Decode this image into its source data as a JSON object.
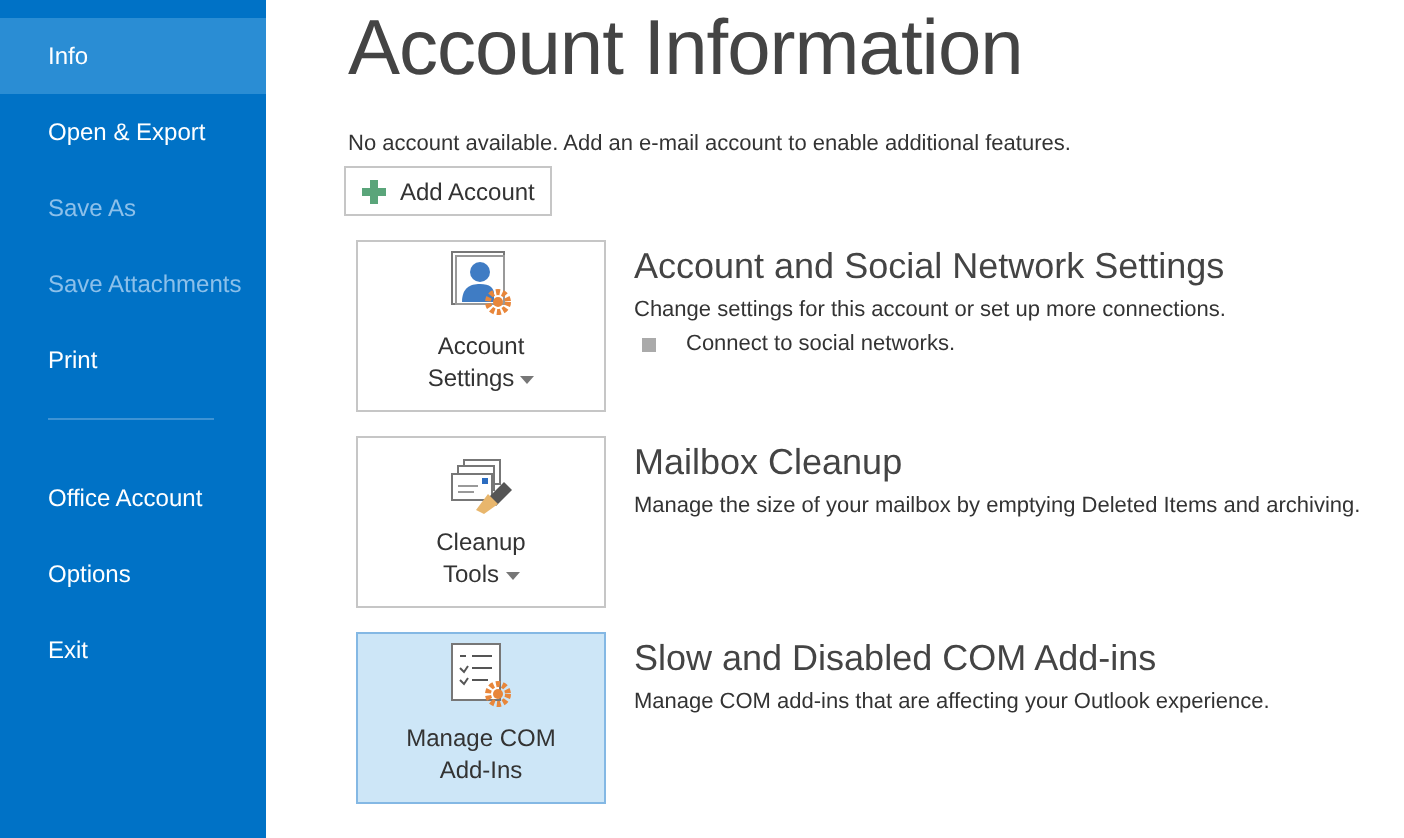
{
  "sidebar": {
    "items": [
      {
        "label": "Info",
        "selected": true,
        "disabled": false
      },
      {
        "label": "Open & Export",
        "selected": false,
        "disabled": false
      },
      {
        "label": "Save As",
        "selected": false,
        "disabled": true
      },
      {
        "label": "Save Attachments",
        "selected": false,
        "disabled": true
      },
      {
        "label": "Print",
        "selected": false,
        "disabled": false
      },
      {
        "kind": "divider"
      },
      {
        "label": "Office Account",
        "selected": false,
        "disabled": false
      },
      {
        "label": "Options",
        "selected": false,
        "disabled": false
      },
      {
        "label": "Exit",
        "selected": false,
        "disabled": false
      }
    ]
  },
  "title": "Account Information",
  "notice": "No account available. Add an e-mail account to enable additional features.",
  "add_button": "Add Account",
  "sections": [
    {
      "kind": "account",
      "button_lines": [
        "Account",
        "Settings"
      ],
      "dropdown": true,
      "highlighted": false,
      "heading": "Account and Social Network Settings",
      "description": "Change settings for this account or set up more connections.",
      "bullets": [
        "Connect to social networks."
      ]
    },
    {
      "kind": "cleanup",
      "button_lines": [
        "Cleanup",
        "Tools"
      ],
      "dropdown": true,
      "highlighted": false,
      "heading": "Mailbox Cleanup",
      "description": "Manage the size of your mailbox by emptying Deleted Items and archiving."
    },
    {
      "kind": "addins",
      "button_lines": [
        "Manage COM",
        "Add-Ins"
      ],
      "dropdown": false,
      "highlighted": true,
      "heading": "Slow and Disabled COM Add-ins",
      "description": "Manage COM add-ins that are affecting your Outlook experience."
    }
  ]
}
